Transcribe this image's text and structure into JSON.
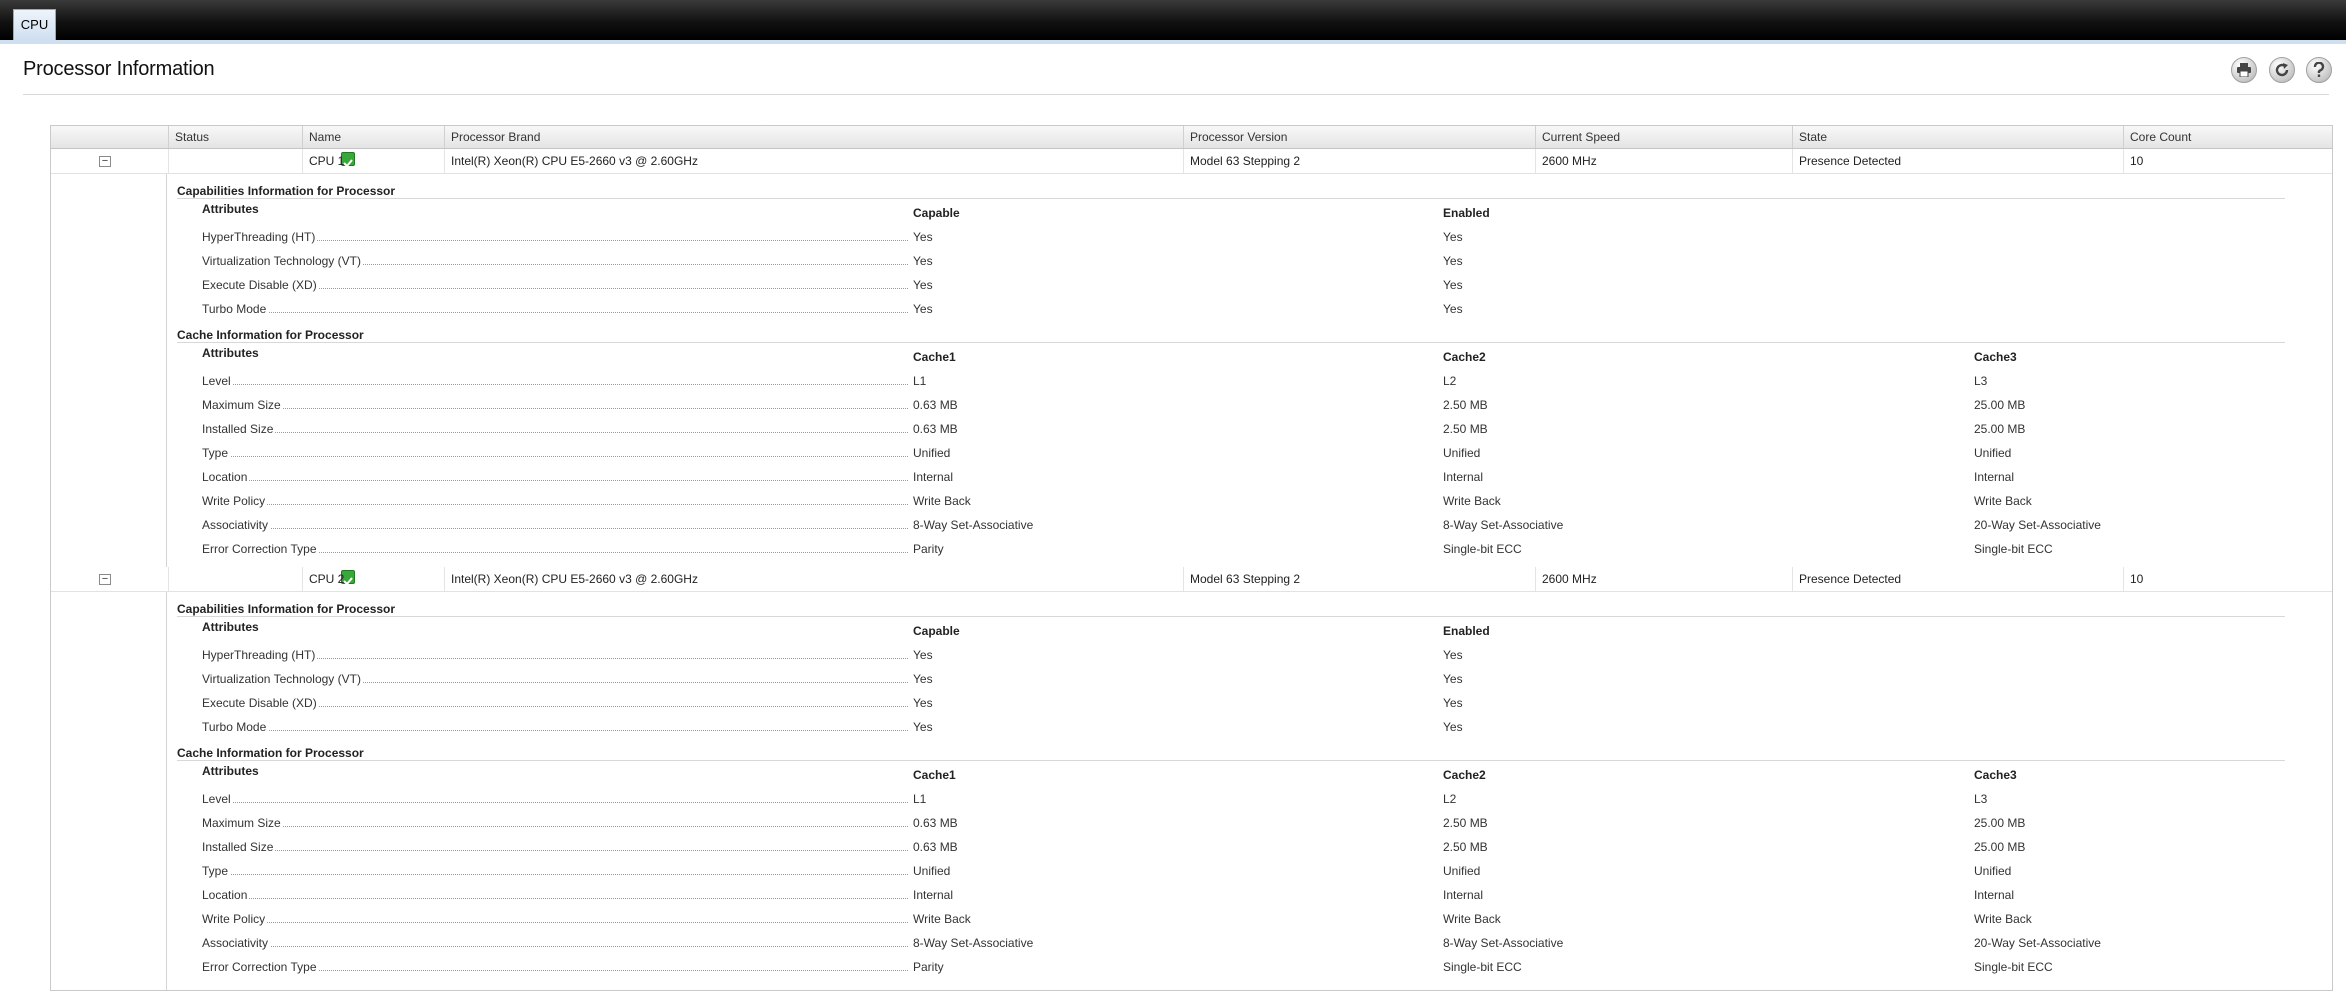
{
  "tabs": [
    {
      "label": "CPU"
    }
  ],
  "page": {
    "title": "Processor Information"
  },
  "toolbar": {
    "icons": [
      "print-icon",
      "refresh-icon",
      "help-icon"
    ]
  },
  "columns": [
    "Status",
    "Name",
    "Processor Brand",
    "Processor Version",
    "Current Speed",
    "State",
    "Core Count"
  ],
  "processors": [
    {
      "toggle": "−",
      "status": "ok",
      "name": "CPU 1",
      "brand": "Intel(R) Xeon(R) CPU E5-2660 v3 @ 2.60GHz",
      "version": "Model 63 Stepping 2",
      "speed": "2600 MHz",
      "state": "Presence Detected",
      "cores": "10",
      "capabilities": {
        "title": "Capabilities Information for Processor",
        "attr_header": "Attributes",
        "headers": [
          "Capable",
          "Enabled"
        ],
        "rows": [
          {
            "label": "HyperThreading (HT)",
            "values": [
              "Yes",
              "Yes"
            ]
          },
          {
            "label": "Virtualization Technology (VT)",
            "values": [
              "Yes",
              "Yes"
            ]
          },
          {
            "label": "Execute Disable (XD)",
            "values": [
              "Yes",
              "Yes"
            ]
          },
          {
            "label": "Turbo Mode",
            "values": [
              "Yes",
              "Yes"
            ]
          }
        ]
      },
      "cache": {
        "title": "Cache Information for Processor",
        "attr_header": "Attributes",
        "headers": [
          "Cache1",
          "Cache2",
          "Cache3"
        ],
        "rows": [
          {
            "label": "Level",
            "values": [
              "L1",
              "L2",
              "L3"
            ]
          },
          {
            "label": "Maximum Size",
            "values": [
              "0.63 MB",
              "2.50 MB",
              "25.00 MB"
            ]
          },
          {
            "label": "Installed Size",
            "values": [
              "0.63 MB",
              "2.50 MB",
              "25.00 MB"
            ]
          },
          {
            "label": "Type",
            "values": [
              "Unified",
              "Unified",
              "Unified"
            ]
          },
          {
            "label": "Location",
            "values": [
              "Internal",
              "Internal",
              "Internal"
            ]
          },
          {
            "label": "Write Policy",
            "values": [
              "Write Back",
              "Write Back",
              "Write Back"
            ]
          },
          {
            "label": "Associativity",
            "values": [
              "8-Way Set-Associative",
              "8-Way Set-Associative",
              "20-Way Set-Associative"
            ]
          },
          {
            "label": "Error Correction Type",
            "values": [
              "Parity",
              "Single-bit ECC",
              "Single-bit ECC"
            ]
          }
        ]
      }
    },
    {
      "toggle": "−",
      "status": "ok",
      "name": "CPU 2",
      "brand": "Intel(R) Xeon(R) CPU E5-2660 v3 @ 2.60GHz",
      "version": "Model 63 Stepping 2",
      "speed": "2600 MHz",
      "state": "Presence Detected",
      "cores": "10",
      "capabilities": {
        "title": "Capabilities Information for Processor",
        "attr_header": "Attributes",
        "headers": [
          "Capable",
          "Enabled"
        ],
        "rows": [
          {
            "label": "HyperThreading (HT)",
            "values": [
              "Yes",
              "Yes"
            ]
          },
          {
            "label": "Virtualization Technology (VT)",
            "values": [
              "Yes",
              "Yes"
            ]
          },
          {
            "label": "Execute Disable (XD)",
            "values": [
              "Yes",
              "Yes"
            ]
          },
          {
            "label": "Turbo Mode",
            "values": [
              "Yes",
              "Yes"
            ]
          }
        ]
      },
      "cache": {
        "title": "Cache Information for Processor",
        "attr_header": "Attributes",
        "headers": [
          "Cache1",
          "Cache2",
          "Cache3"
        ],
        "rows": [
          {
            "label": "Level",
            "values": [
              "L1",
              "L2",
              "L3"
            ]
          },
          {
            "label": "Maximum Size",
            "values": [
              "0.63 MB",
              "2.50 MB",
              "25.00 MB"
            ]
          },
          {
            "label": "Installed Size",
            "values": [
              "0.63 MB",
              "2.50 MB",
              "25.00 MB"
            ]
          },
          {
            "label": "Type",
            "values": [
              "Unified",
              "Unified",
              "Unified"
            ]
          },
          {
            "label": "Location",
            "values": [
              "Internal",
              "Internal",
              "Internal"
            ]
          },
          {
            "label": "Write Policy",
            "values": [
              "Write Back",
              "Write Back",
              "Write Back"
            ]
          },
          {
            "label": "Associativity",
            "values": [
              "8-Way Set-Associative",
              "8-Way Set-Associative",
              "20-Way Set-Associative"
            ]
          },
          {
            "label": "Error Correction Type",
            "values": [
              "Parity",
              "Single-bit ECC",
              "Single-bit ECC"
            ]
          }
        ]
      }
    }
  ]
}
